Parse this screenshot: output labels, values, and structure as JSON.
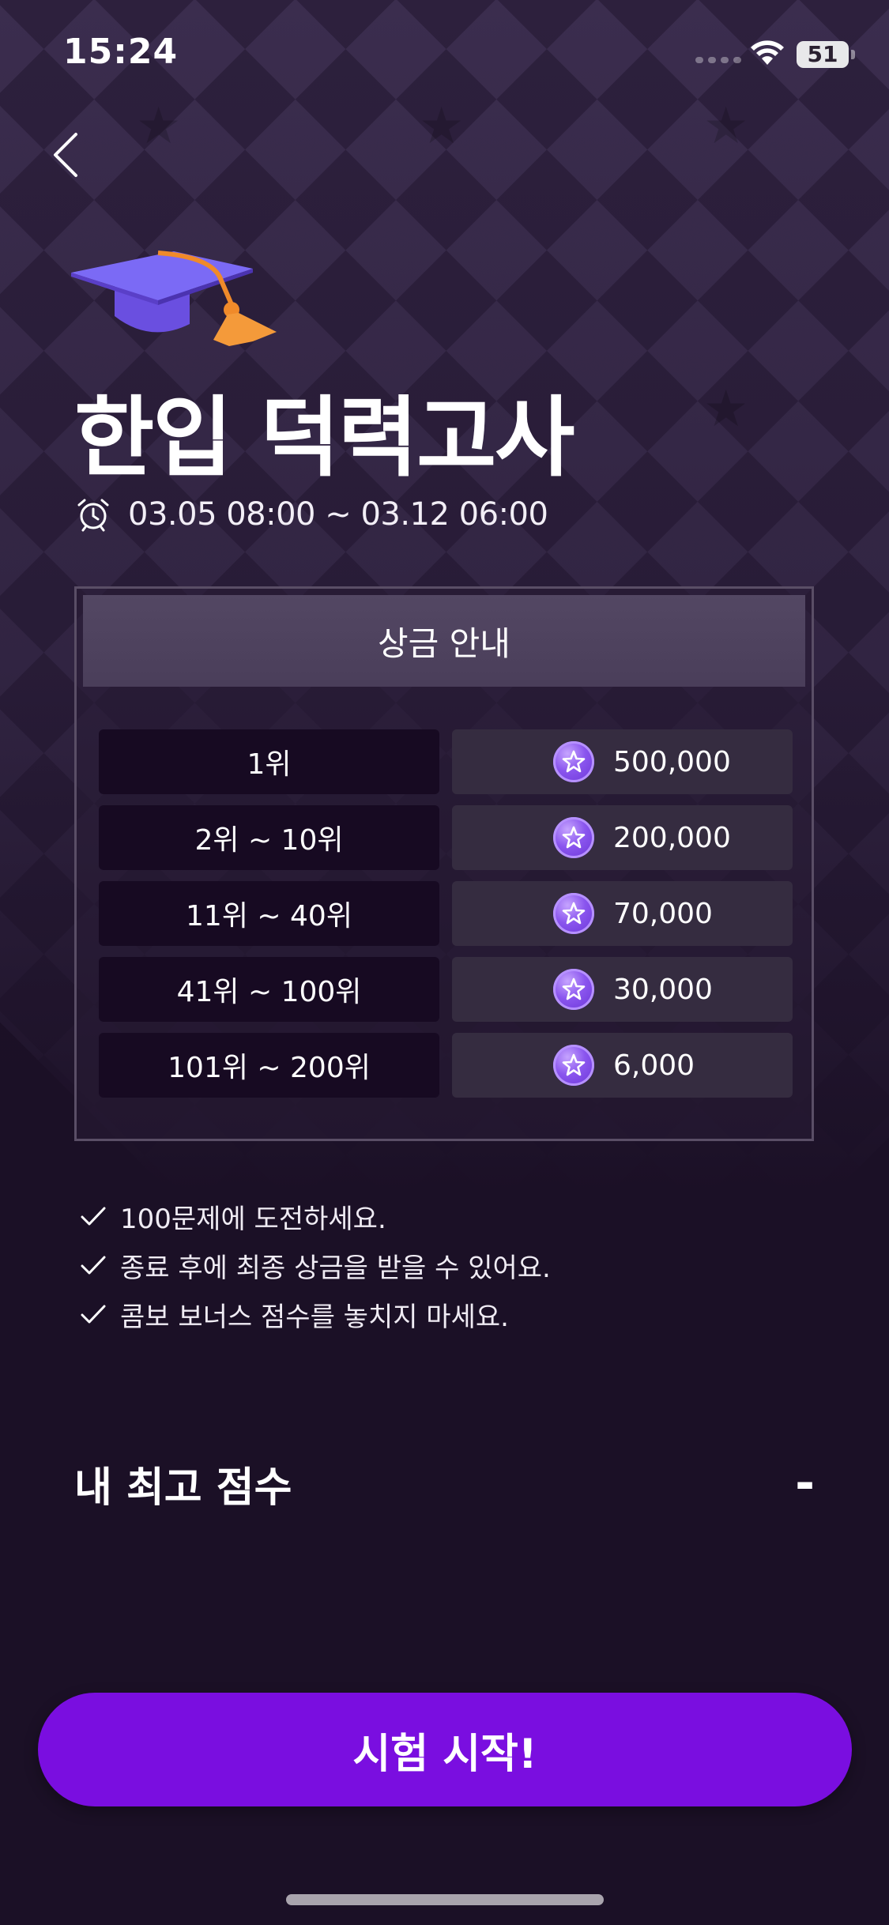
{
  "status_bar": {
    "time": "15:24",
    "battery": "51"
  },
  "header": {
    "back_icon": "chevron-left-icon",
    "hero_icon": "graduation-cap-icon"
  },
  "event": {
    "title": "한입 덕력고사",
    "period_icon": "alarm-clock-icon",
    "period": "03.05 08:00 ~ 03.12 06:00"
  },
  "prize": {
    "heading": "상금 안내",
    "coin_icon": "star-coin-icon",
    "rows": [
      {
        "rank": "1위",
        "reward": "500,000"
      },
      {
        "rank": "2위 ~  10위",
        "reward": "200,000"
      },
      {
        "rank": "11위 ~  40위",
        "reward": "70,000"
      },
      {
        "rank": "41위 ~  100위",
        "reward": "30,000"
      },
      {
        "rank": "101위 ~  200위",
        "reward": "6,000"
      }
    ]
  },
  "notes": [
    "100문제에 도전하세요.",
    "종료 후에 최종 상금을 받을 수 있어요.",
    "콤보 보너스 점수를 놓치지 마세요."
  ],
  "best_score": {
    "label": "내 최고 점수",
    "value": "-"
  },
  "cta": {
    "label": "시험 시작!"
  },
  "colors": {
    "background": "#1b1026",
    "cta": "#7a0ee0",
    "rank_cell": "#170a22",
    "reward_cell": "#352c40"
  }
}
